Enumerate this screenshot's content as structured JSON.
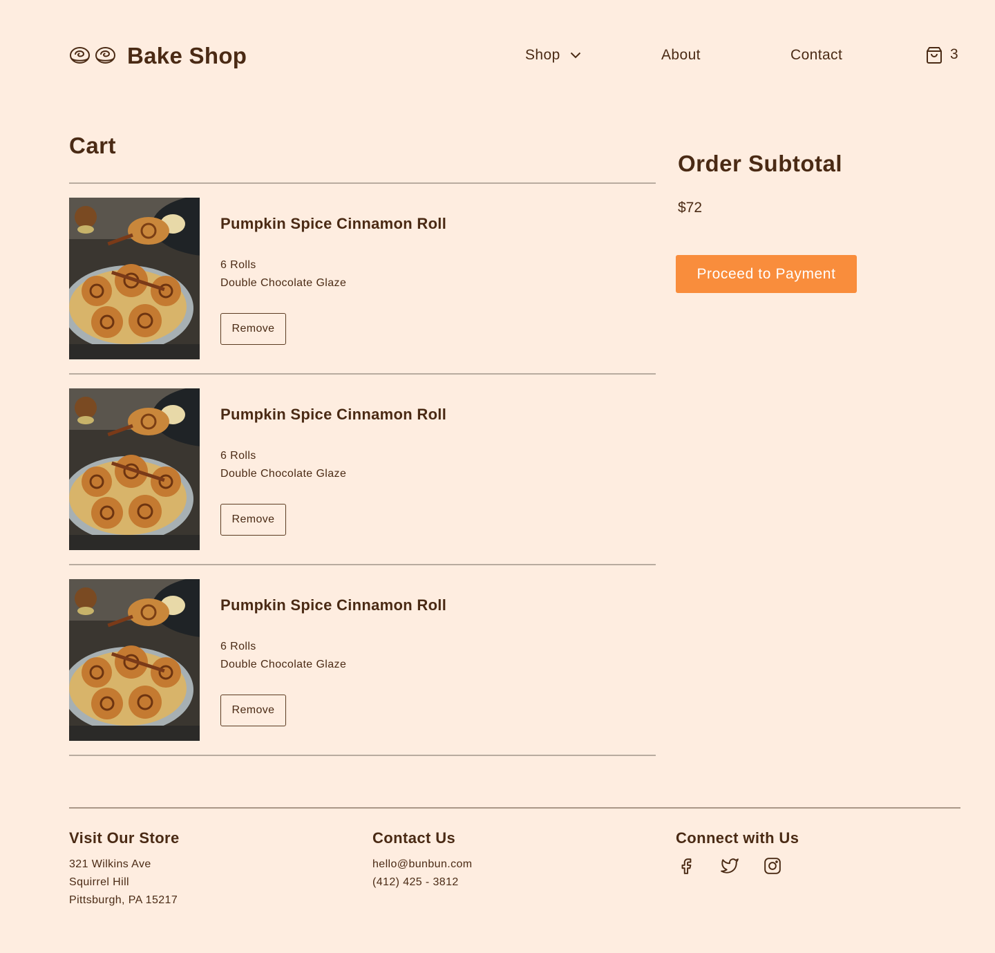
{
  "header": {
    "brand": "Bake Shop",
    "logo_icons": [
      "bun-icon",
      "bun-icon"
    ],
    "nav": {
      "shop": "Shop",
      "about": "About",
      "contact": "Contact"
    },
    "cart_count": "3"
  },
  "cart": {
    "title": "Cart",
    "items": [
      {
        "name": "Pumpkin Spice Cinnamon Roll",
        "quantity": "6 Rolls",
        "glaze": "Double Chocolate Glaze",
        "remove_label": "Remove"
      },
      {
        "name": "Pumpkin Spice Cinnamon Roll",
        "quantity": "6 Rolls",
        "glaze": "Double Chocolate Glaze",
        "remove_label": "Remove"
      },
      {
        "name": "Pumpkin Spice Cinnamon Roll",
        "quantity": "6 Rolls",
        "glaze": "Double Chocolate Glaze",
        "remove_label": "Remove"
      }
    ]
  },
  "summary": {
    "title": "Order Subtotal",
    "amount": "$72",
    "pay_label": "Proceed to Payment"
  },
  "footer": {
    "store": {
      "title": "Visit Our Store",
      "lines": [
        "321 Wilkins Ave",
        "Squirrel Hill",
        "Pittsburgh, PA 15217"
      ]
    },
    "contact": {
      "title": "Contact Us",
      "lines": [
        "hello@bunbun.com",
        "(412) 425 - 3812"
      ]
    },
    "social": {
      "title": "Connect with Us",
      "icons": [
        "facebook-icon",
        "twitter-icon",
        "instagram-icon"
      ]
    }
  },
  "colors": {
    "background": "#feede0",
    "text": "#4a2a14",
    "accent": "#f98d3c",
    "divider": "#b8ab9f"
  }
}
